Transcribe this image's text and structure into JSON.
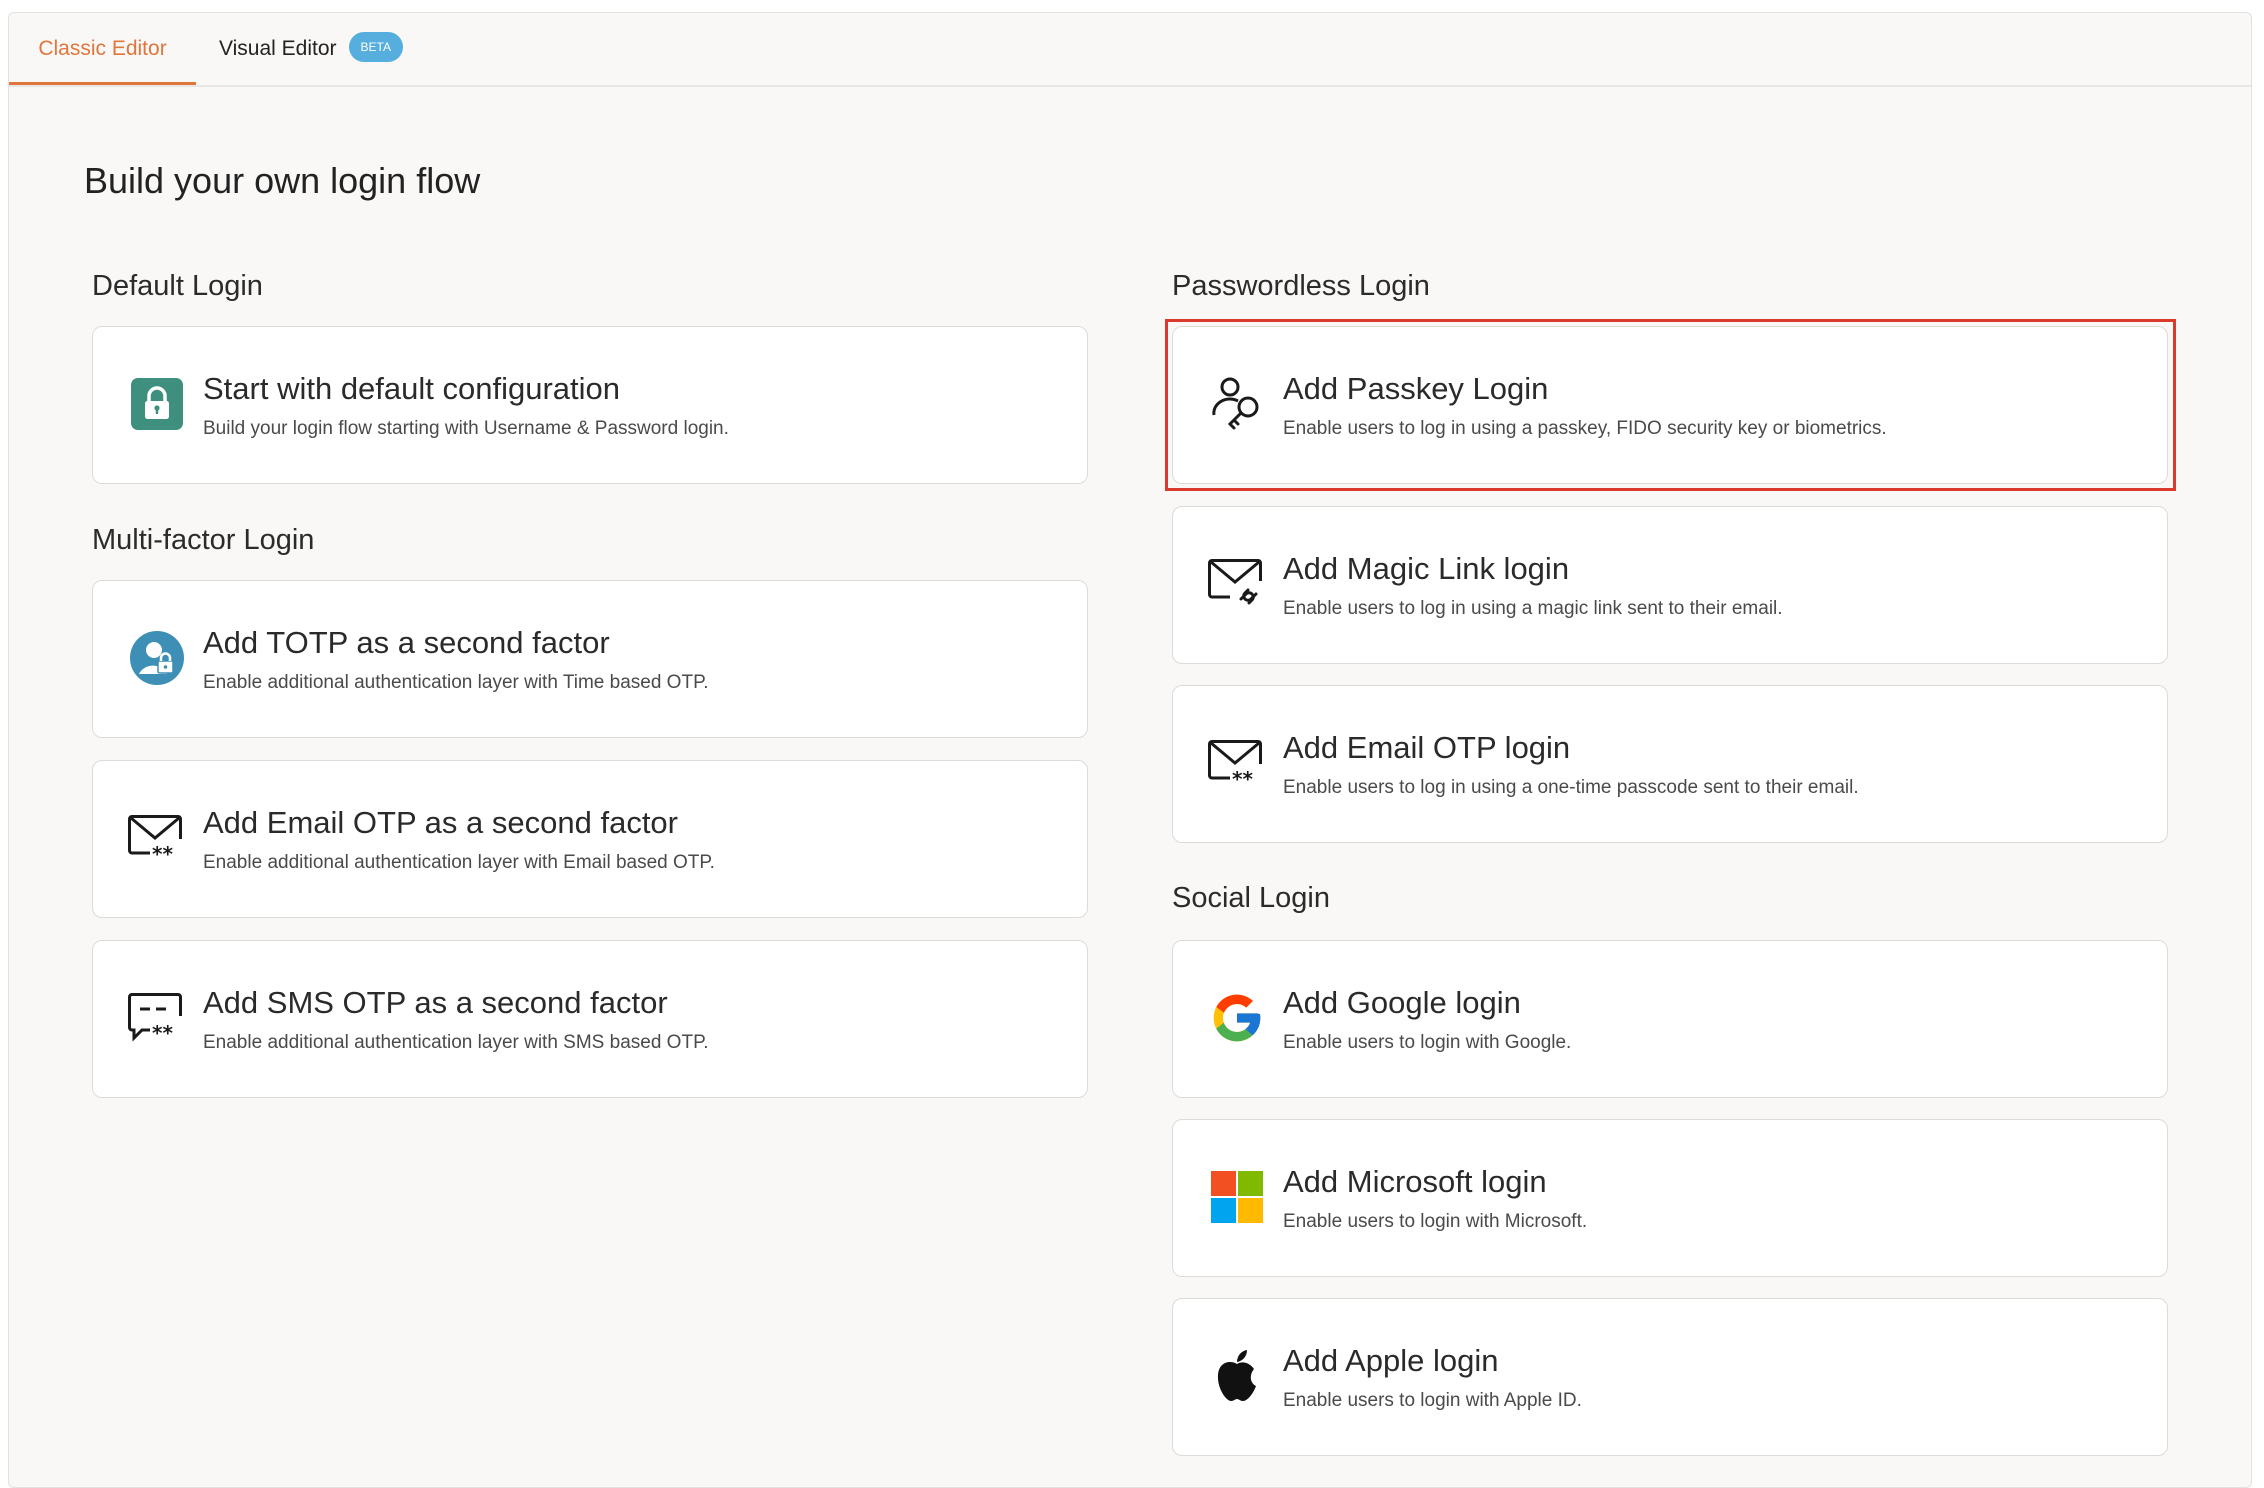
{
  "tabs": [
    {
      "label": "Classic Editor",
      "active": true
    },
    {
      "label": "Visual Editor",
      "badge": "BETA",
      "active": false
    }
  ],
  "page_title": "Build your own login flow",
  "colors": {
    "accent": "#e0763c",
    "badge": "#56aede",
    "highlight": "#d93a2b"
  },
  "sections": {
    "default": {
      "title": "Default Login",
      "cards": [
        {
          "icon": "lock-icon",
          "title": "Start with default configuration",
          "desc": "Build your login flow starting with Username & Password login."
        }
      ]
    },
    "mfa": {
      "title": "Multi-factor Login",
      "cards": [
        {
          "icon": "totp-user-lock-icon",
          "title": "Add TOTP as a second factor",
          "desc": "Enable additional authentication layer with Time based OTP."
        },
        {
          "icon": "email-otp-icon",
          "title": "Add Email OTP as a second factor",
          "desc": "Enable additional authentication layer with Email based OTP."
        },
        {
          "icon": "sms-otp-icon",
          "title": "Add SMS OTP as a second factor",
          "desc": "Enable additional authentication layer with SMS based OTP."
        }
      ]
    },
    "passwordless": {
      "title": "Passwordless Login",
      "cards": [
        {
          "icon": "passkey-icon",
          "title": "Add Passkey Login",
          "desc": "Enable users to log in using a passkey, FIDO security key or biometrics.",
          "highlighted": true
        },
        {
          "icon": "magic-link-icon",
          "title": "Add Magic Link login",
          "desc": "Enable users to log in using a magic link sent to their email."
        },
        {
          "icon": "email-otp-icon",
          "title": "Add Email OTP login",
          "desc": "Enable users to log in using a one-time passcode sent to their email."
        }
      ]
    },
    "social": {
      "title": "Social Login",
      "cards": [
        {
          "icon": "google-icon",
          "title": "Add Google login",
          "desc": "Enable users to login with Google."
        },
        {
          "icon": "microsoft-icon",
          "title": "Add Microsoft login",
          "desc": "Enable users to login with Microsoft."
        },
        {
          "icon": "apple-icon",
          "title": "Add Apple login",
          "desc": "Enable users to login with Apple ID."
        }
      ]
    }
  }
}
